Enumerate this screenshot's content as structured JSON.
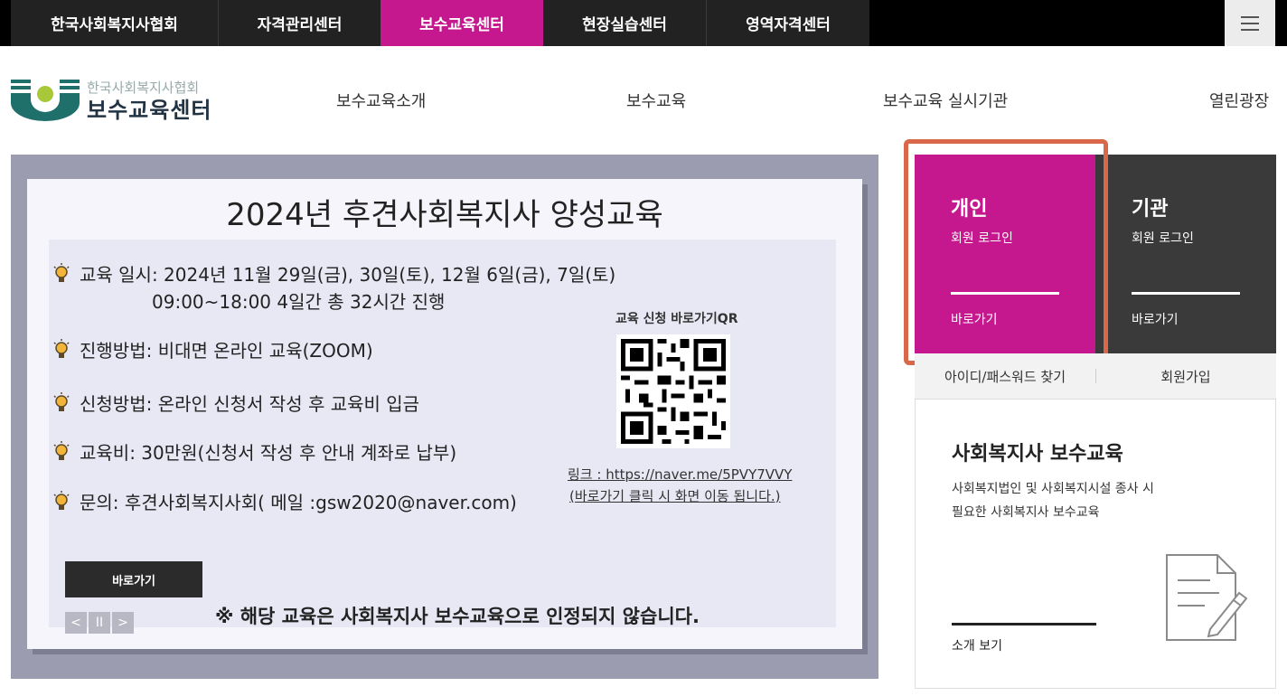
{
  "topnav": {
    "tabs": [
      {
        "label": "한국사회복지사협회"
      },
      {
        "label": "자격관리센터"
      },
      {
        "label": "보수교육센터"
      },
      {
        "label": "현장실습센터"
      },
      {
        "label": "영역자격센터"
      }
    ],
    "active_index": 2,
    "active_color": "#c5188f",
    "menu_icon": "hamburger-icon"
  },
  "logo": {
    "sub": "한국사회복지사협회",
    "main": "보수교육센터"
  },
  "gnb": {
    "items": [
      {
        "label": "보수교육소개"
      },
      {
        "label": "보수교육"
      },
      {
        "label": "보수교육 실시기관"
      },
      {
        "label": "열린광장"
      }
    ]
  },
  "banner": {
    "title": "2024년 후견사회복지사 양성교육",
    "items": [
      {
        "text": "교육 일시: 2024년 11월 29일(금), 30일(토), 12월 6일(금), 7일(토)"
      },
      {
        "text": "진행방법: 비대면 온라인 교육(ZOOM)"
      },
      {
        "text": "신청방법: 온라인 신청서 작성 후 교육비 입금"
      },
      {
        "text": "교육비: 30만원(신청서 작성 후 안내 계좌로 납부)"
      },
      {
        "text": "문의: 후견사회복지사회( 메일 :gsw2020@naver.com)"
      }
    ],
    "schedule_line2": "09:00~18:00 4일간 총 32시간 진행",
    "qr_label": "교육 신청 바로가기QR",
    "qr_link": "링크 : https://naver.me/5PVY7VVY",
    "qr_link_note": "(바로가기 클릭 시 화면 이동 됩니다.)",
    "go_button": "바로가기",
    "notice": "※ 해당 교육은 사회복지사 보수교육으로 인정되지 않습니다.",
    "controls": {
      "prev": "<",
      "pause": "II",
      "next": ">"
    }
  },
  "login": {
    "personal": {
      "title": "개인",
      "sub": "회원 로그인",
      "go": "바로가기",
      "color": "#c5188f"
    },
    "org": {
      "title": "기관",
      "sub": "회원 로그인",
      "go": "바로가기",
      "color": "#3a3a3a"
    },
    "find_account": "아이디/패스워드 찾기",
    "signup": "회원가입"
  },
  "intro": {
    "title": "사회복지사 보수교육",
    "desc_line1": "사회복지법인 및 사회복지시설 종사 시",
    "desc_line2": "필요한 사회복지사 보수교육",
    "more": "소개 보기",
    "icon": "document-edit-icon"
  }
}
